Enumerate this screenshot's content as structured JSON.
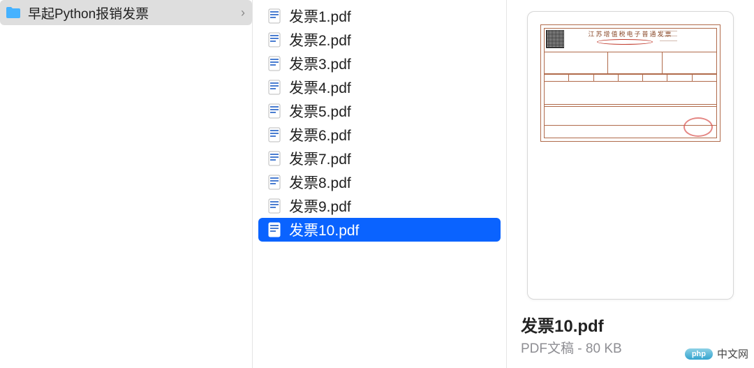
{
  "sidebar": {
    "folder_name": "早起Python报销发票"
  },
  "files": [
    {
      "name": "发票1.pdf"
    },
    {
      "name": "发票2.pdf"
    },
    {
      "name": "发票3.pdf"
    },
    {
      "name": "发票4.pdf"
    },
    {
      "name": "发票5.pdf"
    },
    {
      "name": "发票6.pdf"
    },
    {
      "name": "发票7.pdf"
    },
    {
      "name": "发票8.pdf"
    },
    {
      "name": "发票9.pdf"
    },
    {
      "name": "发票10.pdf"
    }
  ],
  "selected_index": 9,
  "preview": {
    "filename": "发票10.pdf",
    "type_label": "PDF文稿",
    "size_label": "80 KB",
    "invoice_title": "江苏增值税电子普通发票"
  },
  "watermark": {
    "badge": "php",
    "text": "中文网"
  }
}
